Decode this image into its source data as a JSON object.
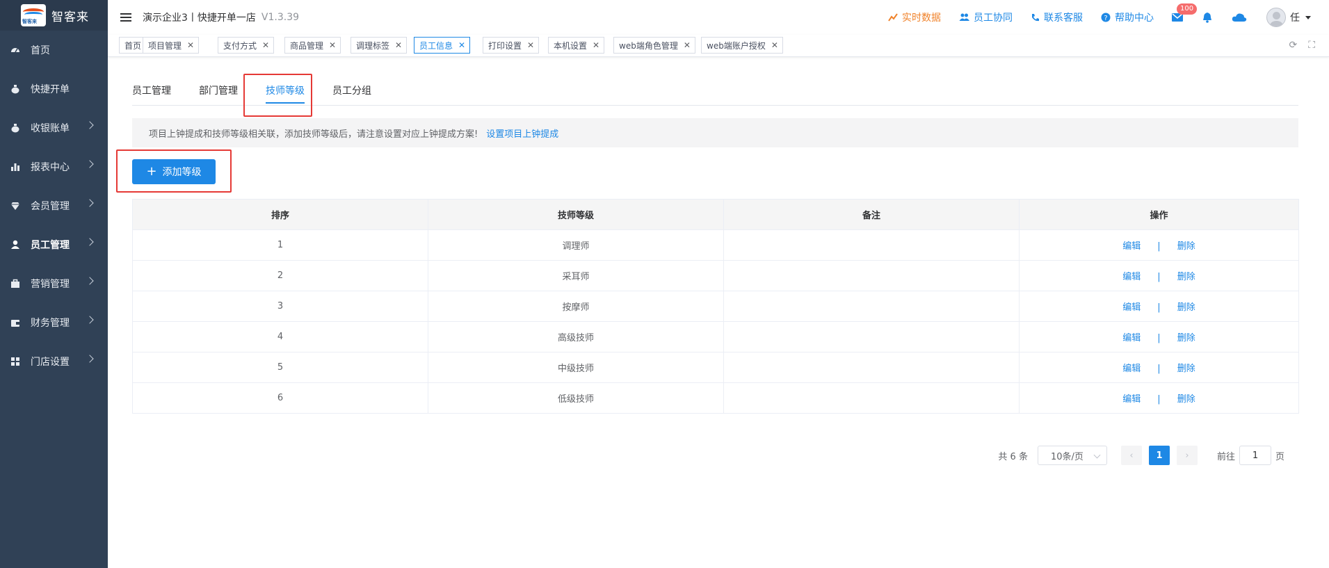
{
  "sidebar": {
    "logo_text": "智客来",
    "logo_small": "智客来",
    "items": [
      {
        "label": "首页"
      },
      {
        "label": "快捷开单"
      },
      {
        "label": "收银账单"
      },
      {
        "label": "报表中心"
      },
      {
        "label": "会员管理"
      },
      {
        "label": "员工管理"
      },
      {
        "label": "营销管理"
      },
      {
        "label": "财务管理"
      },
      {
        "label": "门店设置"
      }
    ]
  },
  "header": {
    "title": "演示企业3丨快捷开单一店",
    "version": "V1.3.39",
    "links": {
      "realtime": "实时数据",
      "collab": "员工协同",
      "service": "联系客服",
      "help": "帮助中心"
    },
    "mail_badge": "100",
    "user_name": "任"
  },
  "tags": [
    {
      "label": "首页"
    },
    {
      "label": "项目管理"
    },
    {
      "label": "支付方式"
    },
    {
      "label": "商品管理"
    },
    {
      "label": "调理标签"
    },
    {
      "label": "员工信息"
    },
    {
      "label": "打印设置"
    },
    {
      "label": "本机设置"
    },
    {
      "label": "web端角色管理"
    },
    {
      "label": "web端账户授权"
    }
  ],
  "tabs": [
    {
      "label": "员工管理"
    },
    {
      "label": "部门管理"
    },
    {
      "label": "技师等级"
    },
    {
      "label": "员工分组"
    }
  ],
  "notice": {
    "text": "项目上钟提成和技师等级相关联，添加技师等级后，请注意设置对应上钟提成方案!",
    "link": "设置项目上钟提成"
  },
  "add_button": "添加等级",
  "table": {
    "headers": [
      "排序",
      "技师等级",
      "备注",
      "操作"
    ],
    "edit_label": "编辑",
    "delete_label": "删除",
    "rows": [
      {
        "order": "1",
        "level": "调理师",
        "note": ""
      },
      {
        "order": "2",
        "level": "采耳师",
        "note": ""
      },
      {
        "order": "3",
        "level": "按摩师",
        "note": ""
      },
      {
        "order": "4",
        "level": "高级技师",
        "note": ""
      },
      {
        "order": "5",
        "level": "中级技师",
        "note": ""
      },
      {
        "order": "6",
        "level": "低级技师",
        "note": ""
      }
    ]
  },
  "pagination": {
    "total": "共 6 条",
    "page_size": "10条/页",
    "current_page": "1",
    "goto_label": "前往",
    "goto_value": "1",
    "page_suffix": "页"
  },
  "colors": {
    "sidebar_bg": "#304156",
    "primary": "#1e88e5",
    "accent_orange": "#f0822a",
    "highlight_red": "#e53935"
  }
}
